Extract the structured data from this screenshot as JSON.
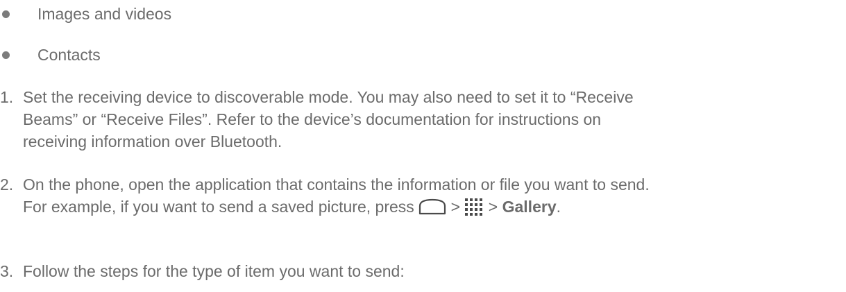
{
  "bullets": [
    {
      "text": "Images and videos",
      "icon": "bullet-dot"
    },
    {
      "text": "Contacts",
      "icon": "bullet-dot"
    }
  ],
  "steps": [
    {
      "number": "1.",
      "lines": [
        "Set the receiving device to discoverable mode. You may also need to set it to “Receive",
        "Beams” or “Receive Files”. Refer to the device’s documentation for instructions on",
        "receiving information over Bluetooth."
      ]
    },
    {
      "number": "2.",
      "line1": "On the phone, open the application that contains the information or file you want to send.",
      "line2_prefix": "For example, if you want to send a saved picture, press",
      "separator": ">",
      "home_icon": "home-icon",
      "apps_icon": "apps-grid-icon",
      "gallery_label": "Gallery",
      "line2_suffix": "."
    },
    {
      "number": "3.",
      "line1": "Follow the steps for the type of item you want to send:"
    }
  ]
}
